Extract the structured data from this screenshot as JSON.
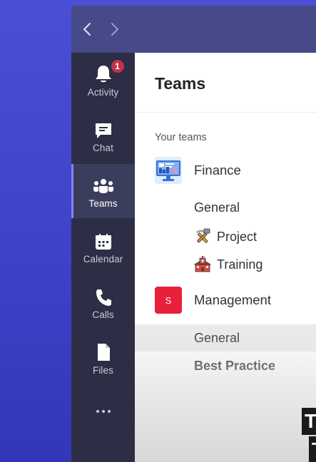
{
  "rail": {
    "items": [
      {
        "label": "Activity",
        "icon": "bell-icon",
        "badge": "1"
      },
      {
        "label": "Chat",
        "icon": "chat-icon"
      },
      {
        "label": "Teams",
        "icon": "teams-icon",
        "active": true
      },
      {
        "label": "Calendar",
        "icon": "calendar-icon"
      },
      {
        "label": "Calls",
        "icon": "phone-icon"
      },
      {
        "label": "Files",
        "icon": "file-icon"
      }
    ],
    "more_icon": "more-dots-icon"
  },
  "main": {
    "title": "Teams",
    "section_label": "Your teams",
    "teams": [
      {
        "name": "Finance",
        "avatar_icon": "finance-team-avatar",
        "channels": [
          {
            "name": "General"
          },
          {
            "name": "Project",
            "emoji": "pick-hammer-icon"
          },
          {
            "name": "Training",
            "emoji": "school-building-icon"
          }
        ]
      },
      {
        "name": "Management",
        "avatar_letter": "S",
        "avatar_color": "#e8203a",
        "channels": [
          {
            "name": "General",
            "selected": true
          },
          {
            "name": "Best Practice",
            "bold": true
          }
        ]
      }
    ]
  },
  "caption": {
    "text1": "T",
    "text2": "T"
  },
  "colors": {
    "background": "#4148cc",
    "titlebar": "#464a88",
    "rail": "#2d2e45",
    "accent": "#7f85f5",
    "badge": "#c4314b"
  }
}
